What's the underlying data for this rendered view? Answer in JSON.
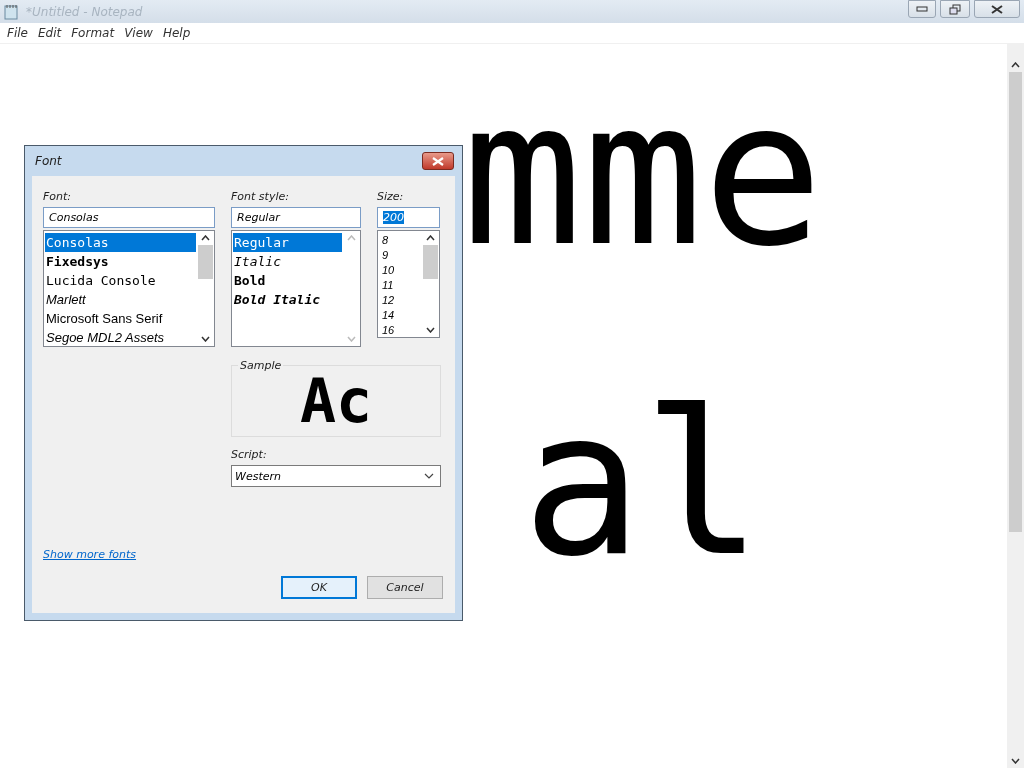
{
  "window": {
    "title": "*Untitled - Notepad"
  },
  "menu": [
    {
      "label": "File"
    },
    {
      "label": "Edit"
    },
    {
      "label": "Format"
    },
    {
      "label": "View"
    },
    {
      "label": "Help"
    }
  ],
  "editor": {
    "lines": [
      {
        "text": "mme"
      },
      {
        "text": "al"
      }
    ]
  },
  "font_dialog": {
    "title": "Font",
    "font": {
      "label": "Font:",
      "value": "Consolas",
      "items": [
        {
          "label": "Consolas",
          "kind": "mono",
          "selected": true
        },
        {
          "label": "Fixedsys",
          "kind": "mono-bold",
          "selected": false
        },
        {
          "label": "Lucida Console",
          "kind": "mono",
          "selected": false
        },
        {
          "label": "Marlett",
          "kind": "italic",
          "selected": false
        },
        {
          "label": "Microsoft Sans Serif",
          "kind": "sans",
          "selected": false
        },
        {
          "label": "Segoe MDL2 Assets",
          "kind": "italic",
          "selected": false
        }
      ],
      "scroll_disabled": false
    },
    "style": {
      "label": "Font style:",
      "value": "Regular",
      "items": [
        {
          "label": "Regular",
          "kind": "mono",
          "selected": true
        },
        {
          "label": "Italic",
          "kind": "mono-italic",
          "selected": false
        },
        {
          "label": "Bold",
          "kind": "mono-bold",
          "selected": false
        },
        {
          "label": "Bold Italic",
          "kind": "mono-bold-italic",
          "selected": false
        }
      ],
      "scroll_disabled": true
    },
    "size": {
      "label": "Size:",
      "value": "200",
      "value_selected": true,
      "items": [
        {
          "label": "8",
          "kind": "italic",
          "selected": false
        },
        {
          "label": "9",
          "kind": "italic",
          "selected": false
        },
        {
          "label": "10",
          "kind": "italic",
          "selected": false
        },
        {
          "label": "11",
          "kind": "italic",
          "selected": false
        },
        {
          "label": "12",
          "kind": "italic",
          "selected": false
        },
        {
          "label": "14",
          "kind": "italic",
          "selected": false
        },
        {
          "label": "16",
          "kind": "italic",
          "selected": false
        }
      ],
      "scroll_disabled": false
    },
    "sample": {
      "label": "Sample",
      "text": "Ac"
    },
    "script": {
      "label": "Script:",
      "value": "Western"
    },
    "link": "Show more fonts",
    "buttons": [
      {
        "label": "OK",
        "default": true
      },
      {
        "label": "Cancel",
        "default": false
      }
    ]
  }
}
